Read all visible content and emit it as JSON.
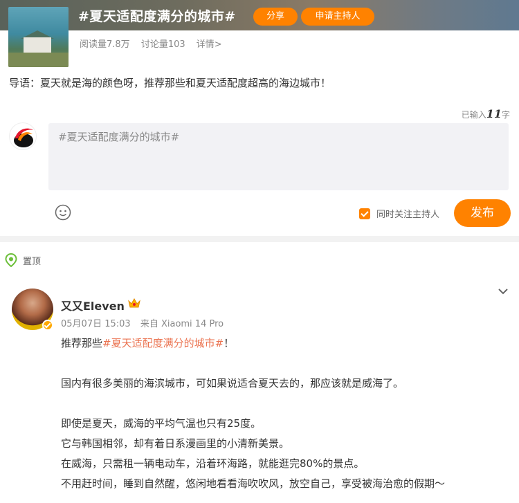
{
  "topic": {
    "title": "#夏天适配度满分的城市#",
    "share_label": "分享",
    "apply_host_label": "申请主持人",
    "read_count": "阅读量7.8万",
    "discuss_count": "讨论量103",
    "details_label": "详情>",
    "intro": "导语：夏天就是海的颜色呀，推荐那些和夏天适配度超高的海边城市！"
  },
  "composer": {
    "counter_prefix": "已输入",
    "counter_value": "11",
    "counter_suffix": "字",
    "value": "#夏天适配度满分的城市#",
    "follow_host_label": "同时关注主持人",
    "follow_host_checked": true,
    "publish_label": "发布"
  },
  "feed": {
    "pinned_label": "置顶",
    "post": {
      "author": "又又Eleven",
      "date": "05月07日 15:03",
      "source": "来自 Xiaomi 14 Pro",
      "line1_prefix": "推荐那些",
      "line1_tag": "#夏天适配度满分的城市#",
      "line1_suffix": "！",
      "line2": "国内有很多美丽的海滨城市，可如果说适合夏天去的，那应该就是威海了。",
      "line3": "即使是夏天，威海的平均气温也只有25度。",
      "line4": "它与韩国相邻，却有着日系漫画里的小清新美景。",
      "line5": "在威海，只需租一辆电动车，沿着环海路，就能逛完80%的景点。",
      "line6": "不用赶时间，睡到自然醒，悠闲地看看海吹吹风，放空自己，享受被海治愈的假期～"
    }
  },
  "colors": {
    "accent": "#ff8200",
    "tag": "#eb7350",
    "pin_icon": "#6cbf3a"
  }
}
